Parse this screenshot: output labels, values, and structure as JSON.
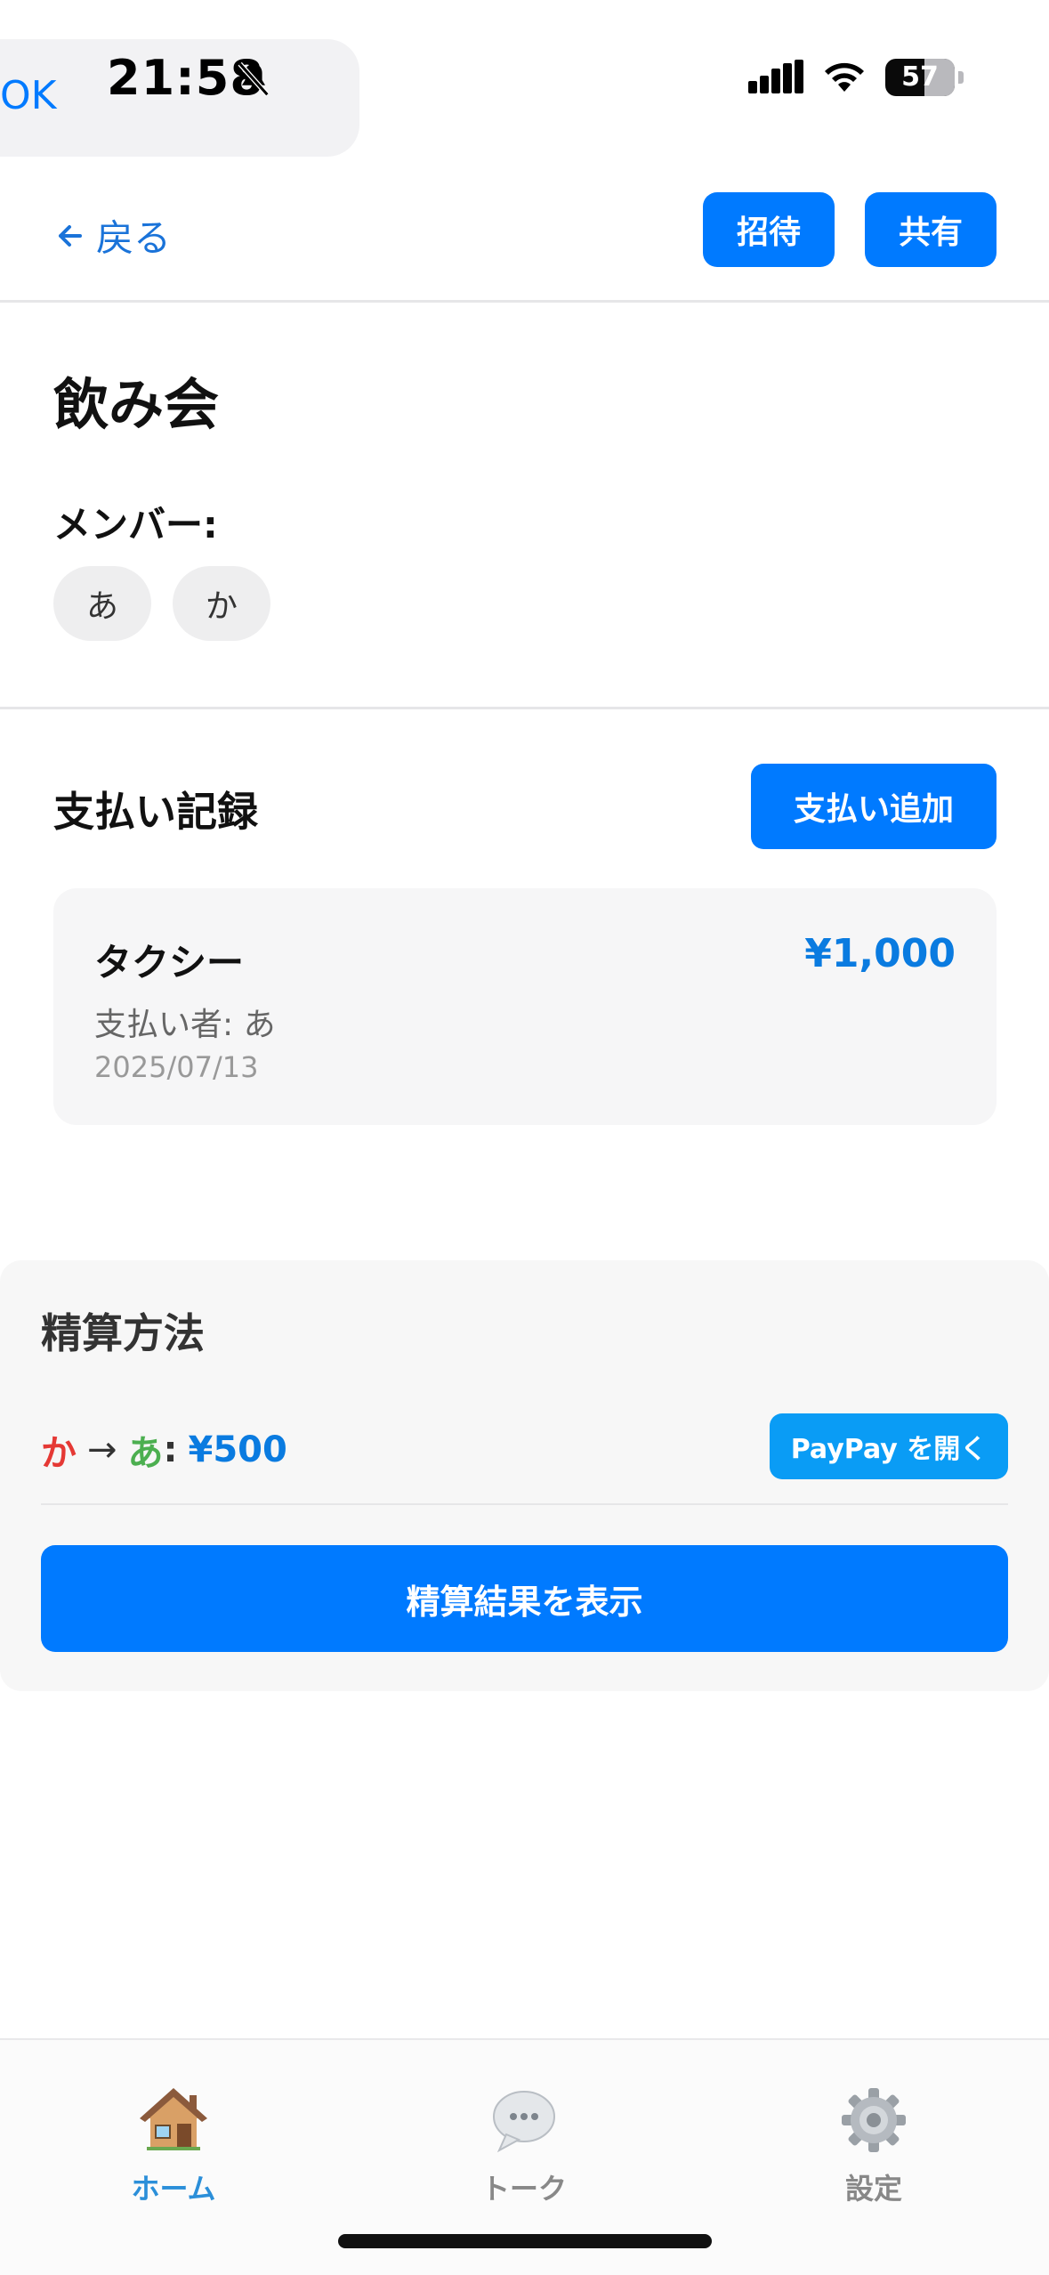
{
  "status_bar": {
    "back_app": "OK",
    "time": "21:58",
    "battery": "57",
    "icons": [
      "bell-slash-icon",
      "signal-icon",
      "wifi-icon",
      "battery-icon"
    ]
  },
  "header": {
    "back_label": "戻る",
    "invite_label": "招待",
    "share_label": "共有"
  },
  "event": {
    "title": "飲み会",
    "members_label": "メンバー:",
    "members": [
      "あ",
      "か"
    ]
  },
  "payments": {
    "title": "支払い記録",
    "add_label": "支払い追加",
    "items": [
      {
        "name": "タクシー",
        "amount": "¥1,000",
        "payer": "支払い者: あ",
        "date": "2025/07/13"
      }
    ]
  },
  "settlement": {
    "title": "精算方法",
    "transfers": [
      {
        "from": "か",
        "arrow": "→",
        "to": "あ",
        "colon": ":",
        "amount": "¥500"
      }
    ],
    "paypay_label": "PayPay を開く",
    "show_result_label": "精算結果を表示"
  },
  "tabs": [
    {
      "label": "ホーム",
      "icon": "house-icon",
      "active": true
    },
    {
      "label": "トーク",
      "icon": "speech-bubble-icon",
      "active": false
    },
    {
      "label": "設定",
      "icon": "gear-icon",
      "active": false
    }
  ],
  "colors": {
    "accent": "#007aff",
    "paypay": "#0a9cf5",
    "amount": "#0a7be0",
    "from_member": "#e53935",
    "to_member": "#4caf50",
    "active_tab": "#2b8fd9"
  }
}
